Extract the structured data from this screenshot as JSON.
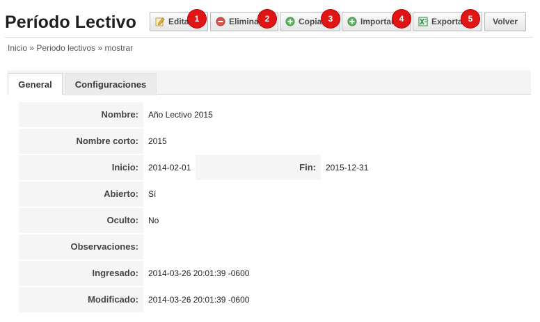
{
  "page": {
    "title": "Período Lectivo"
  },
  "toolbar": {
    "edit_label": "Editar",
    "delete_label": "Eliminar",
    "copy_label": "Copiar",
    "import_label": "Importar",
    "export_label": "Exportar",
    "back_label": "Volver",
    "badges": [
      "1",
      "2",
      "3",
      "4",
      "5"
    ]
  },
  "breadcrumb": {
    "items": [
      "Inicio",
      "Periodo lectivos",
      "mostrar"
    ],
    "separator": "»"
  },
  "tabs": [
    {
      "label": "General",
      "active": true
    },
    {
      "label": "Configuraciones",
      "active": false
    }
  ],
  "fields": {
    "nombre": {
      "label": "Nombre:",
      "value": "Año Lectivo 2015"
    },
    "nombre_corto": {
      "label": "Nombre corto:",
      "value": "2015"
    },
    "inicio": {
      "label": "Inicio:",
      "value": "2014-02-01"
    },
    "fin": {
      "label": "Fin:",
      "value": "2015-12-31"
    },
    "abierto": {
      "label": "Abierto:",
      "value": "Sí"
    },
    "oculto": {
      "label": "Oculto:",
      "value": "No"
    },
    "observaciones": {
      "label": "Observaciones:",
      "value": ""
    },
    "ingresado": {
      "label": "Ingresado:",
      "value": "2014-03-26 20:01:39 -0600"
    },
    "modificado": {
      "label": "Modificado:",
      "value": "2014-03-26 20:01:39 -0600"
    }
  },
  "colors": {
    "badge": "#e01616",
    "delete_icon": "#d9534f",
    "add_icon": "#5cb85c",
    "export_icon": "#2e8b3d",
    "edit_icon": "#e8b84a"
  },
  "icons": {
    "edit": "pencil-note-icon",
    "delete": "minus-circle-icon",
    "copy": "plus-circle-icon",
    "import": "plus-circle-icon",
    "export": "spreadsheet-icon"
  }
}
